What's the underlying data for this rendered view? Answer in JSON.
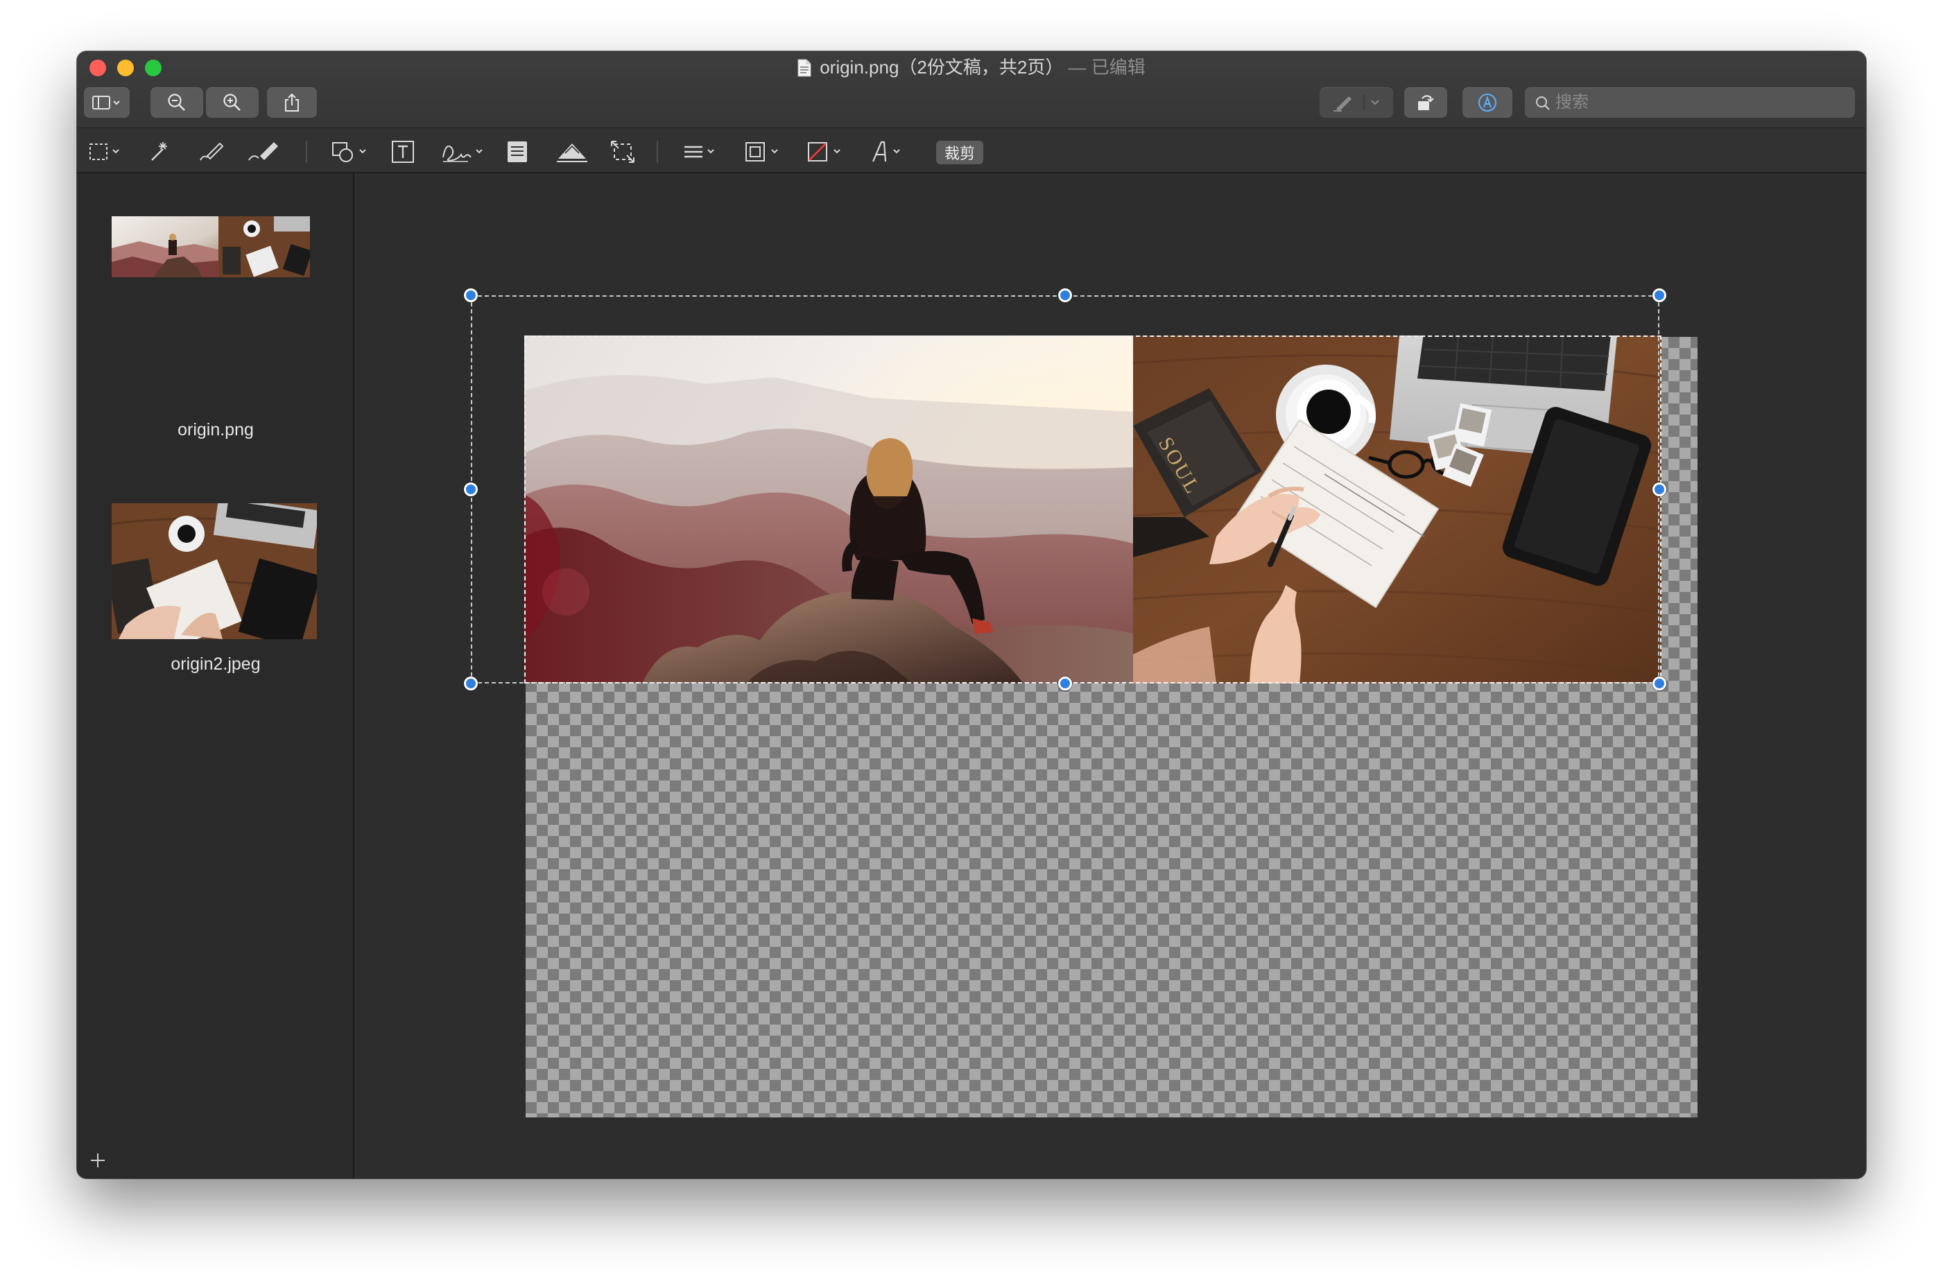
{
  "window": {
    "title": "origin.png（2份文稿，共2页）",
    "edited_suffix": " — 已编辑"
  },
  "toolbar": {
    "left_buttons": [
      "sidebar-toggle-icon",
      "zoom-out-icon",
      "zoom-in-icon",
      "share-icon"
    ],
    "right_buttons": [
      "highlight-pen-icon",
      "rotate-icon",
      "markup-icon"
    ],
    "search_placeholder": "搜索"
  },
  "markup_toolbar": {
    "tools": [
      "rectangular-selection-icon",
      "instant-alpha-icon",
      "sketch-icon",
      "draw-icon",
      "shapes-icon",
      "text-icon",
      "sign-icon",
      "note-icon",
      "adjust-color-icon",
      "adjust-size-icon",
      "shape-style-icon",
      "border-color-icon",
      "fill-color-icon",
      "text-style-icon"
    ],
    "crop_label": "裁剪"
  },
  "sidebar": {
    "items": [
      {
        "label": "origin.png",
        "selected": true
      },
      {
        "label": "origin2.jpeg",
        "selected": false
      }
    ],
    "add_icon": "plus-icon"
  },
  "canvas": {
    "photo_left": "person-sitting-on-mountain-rock-at-sunset",
    "photo_right": "desk-with-coffee-laptop-notebook-tablet",
    "book_text": "SOUL",
    "selection_handle_color": "#2f7fe0"
  }
}
